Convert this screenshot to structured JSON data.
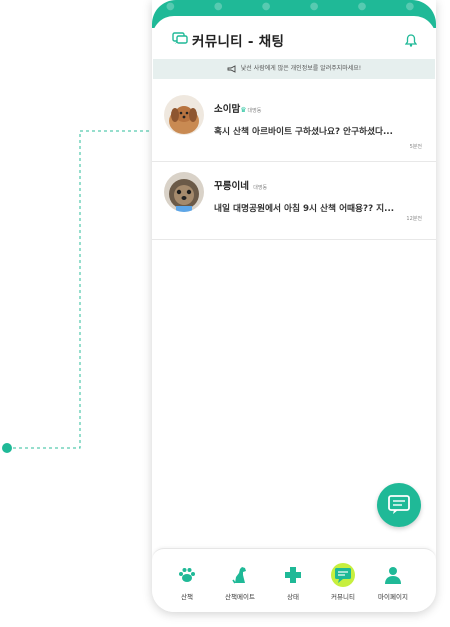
{
  "header": {
    "title": "커뮤니티 - 채팅"
  },
  "notice": {
    "text": "낯선 사람에게 많은 개인정보를 알려주지마세요!"
  },
  "chats": [
    {
      "name": "소이맘",
      "badge": "대명동",
      "message": "혹시 산책 아르바이트 구하셨나요? 안구하셨다...",
      "time": "5분전"
    },
    {
      "name": "꾸릉이네",
      "badge": "대명동",
      "message": "내일 대명공원에서 아침 9시 산책 어때용?? 지...",
      "time": "12분전"
    }
  ],
  "tabs": [
    {
      "label": "산책",
      "icon": "paw-icon"
    },
    {
      "label": "산책메이트",
      "icon": "dog-sitting-icon"
    },
    {
      "label": "상태",
      "icon": "health-cross-icon"
    },
    {
      "label": "커뮤니티",
      "icon": "chat-bubble-icon",
      "active": true
    },
    {
      "label": "마이페이지",
      "icon": "person-icon"
    }
  ],
  "colors": {
    "brand": "#1fb997",
    "active_tab_highlight": "#c7ef3e",
    "notice_bg": "#e6efee"
  }
}
